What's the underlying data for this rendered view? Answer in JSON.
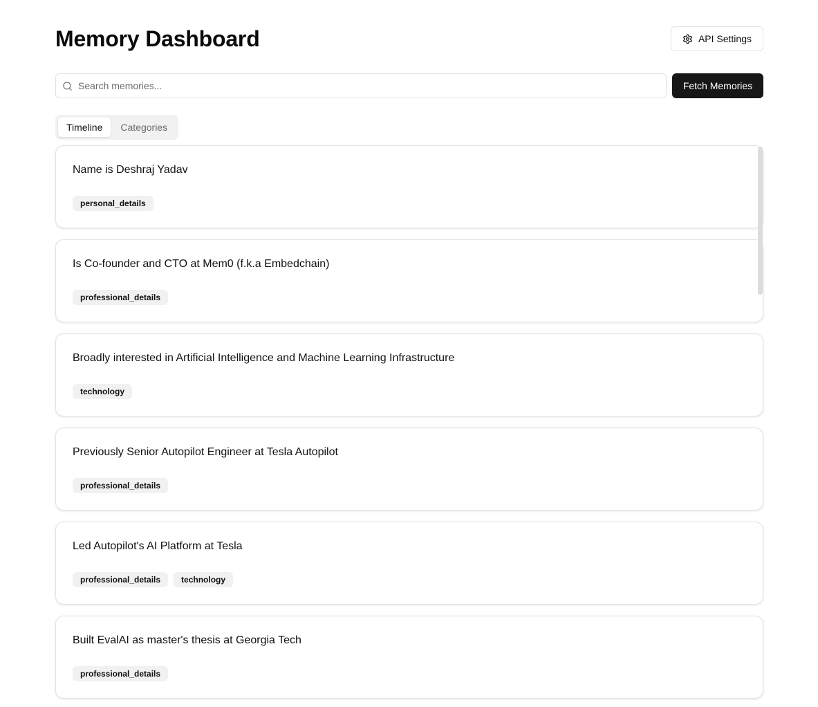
{
  "header": {
    "title": "Memory Dashboard",
    "api_settings_label": "API Settings",
    "api_settings_icon": "gear-icon"
  },
  "search": {
    "placeholder": "Search memories...",
    "value": "",
    "icon": "search-icon",
    "fetch_label": "Fetch Memories"
  },
  "tabs": [
    {
      "label": "Timeline",
      "active": true
    },
    {
      "label": "Categories",
      "active": false
    }
  ],
  "memories": [
    {
      "text": "Name is Deshraj Yadav",
      "tags": [
        "personal_details"
      ]
    },
    {
      "text": "Is Co-founder and CTO at Mem0 (f.k.a Embedchain)",
      "tags": [
        "professional_details"
      ]
    },
    {
      "text": "Broadly interested in Artificial Intelligence and Machine Learning Infrastructure",
      "tags": [
        "technology"
      ]
    },
    {
      "text": "Previously Senior Autopilot Engineer at Tesla Autopilot",
      "tags": [
        "professional_details"
      ]
    },
    {
      "text": "Led Autopilot's AI Platform at Tesla",
      "tags": [
        "professional_details",
        "technology"
      ]
    },
    {
      "text": "Built EvalAI as master's thesis at Georgia Tech",
      "tags": [
        "professional_details"
      ]
    }
  ],
  "colors": {
    "primary_button": "#171717",
    "tag_background": "#f1f1f1",
    "border": "#e3e3e3"
  }
}
